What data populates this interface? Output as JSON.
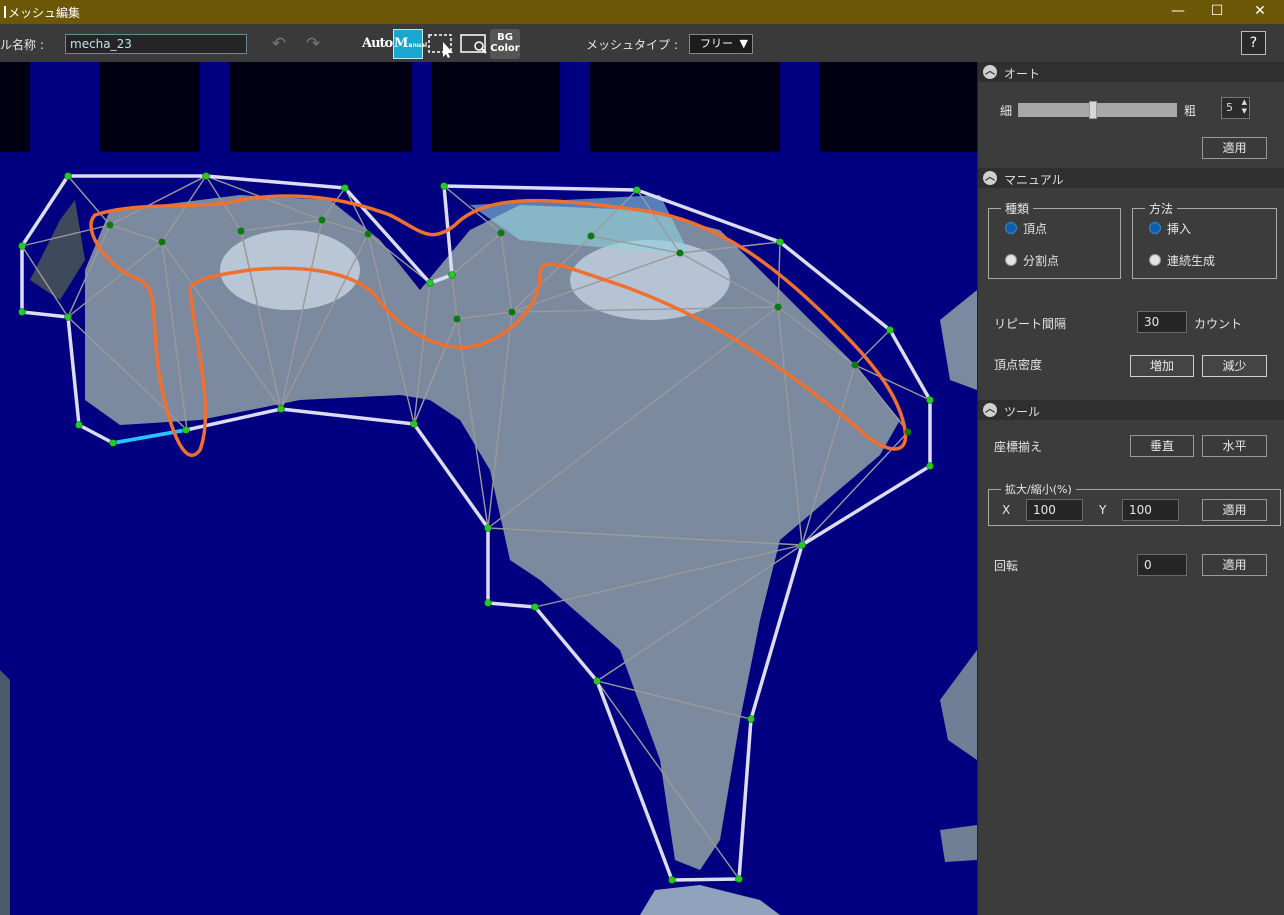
{
  "window": {
    "title": "メッシュ編集",
    "minimize_glyph": "—",
    "maximize_glyph": "☐",
    "close_glyph": "✕"
  },
  "toolbar": {
    "name_label": "ル名称 :",
    "name_value": "mecha_23",
    "undo_icon": "undo-icon",
    "redo_icon": "redo-icon",
    "auto_label": "Auto",
    "manual_label": "M",
    "manual_small": "anual",
    "bg_label_1": "BG",
    "bg_label_2": "Color",
    "mesh_type_label": "メッシュタイプ :",
    "mesh_type_value": "フリー",
    "help_label": "?"
  },
  "panel": {
    "auto": {
      "title": "オート",
      "fine_label": "細",
      "coarse_label": "粗",
      "level": 5,
      "slider_fraction": 0.6,
      "apply_label": "適用"
    },
    "manual": {
      "title": "マニュアル",
      "kind_legend": "種類",
      "kind_options": [
        "頂点",
        "分割点"
      ],
      "kind_selected": 0,
      "method_legend": "方法",
      "method_options": [
        "挿入",
        "連続生成"
      ],
      "method_selected": 0,
      "repeat_label": "リピート間隔",
      "repeat_value": "30",
      "repeat_unit": "カウント",
      "density_label": "頂点密度",
      "increase_label": "増加",
      "decrease_label": "減少"
    },
    "tool": {
      "title": "ツール",
      "align_label": "座標揃え",
      "vertical_label": "垂直",
      "horizontal_label": "水平",
      "scale_legend": "拡大/縮小(%)",
      "x_label": "X",
      "x_value": "100",
      "y_label": "Y",
      "y_value": "100",
      "scale_apply_label": "適用",
      "rotate_label": "回転",
      "rotate_value": "0",
      "rotate_apply_label": "適用"
    }
  },
  "colors": {
    "titlebar": "#6b5705",
    "canvas_bg": "#010080",
    "mesh_outline": "#d6d6f0",
    "mesh_inner": "#9a9a9a",
    "vertex": "#22cc22",
    "contour": "#f07030",
    "selected_edge": "#1ec8ff",
    "accent": "#1aa6cf"
  }
}
